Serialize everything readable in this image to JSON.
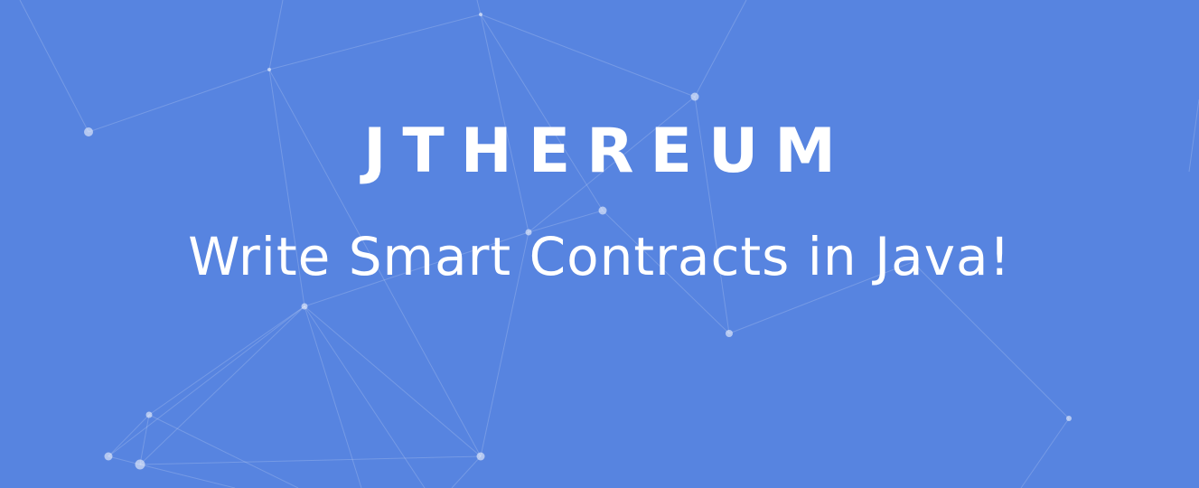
{
  "banner": {
    "title": "JTHEREUM",
    "subtitle": "Write Smart Contracts in Java!",
    "background_color": "#5784e0",
    "text_color": "#ffffff",
    "decoration": "network-nodes-graphic"
  }
}
